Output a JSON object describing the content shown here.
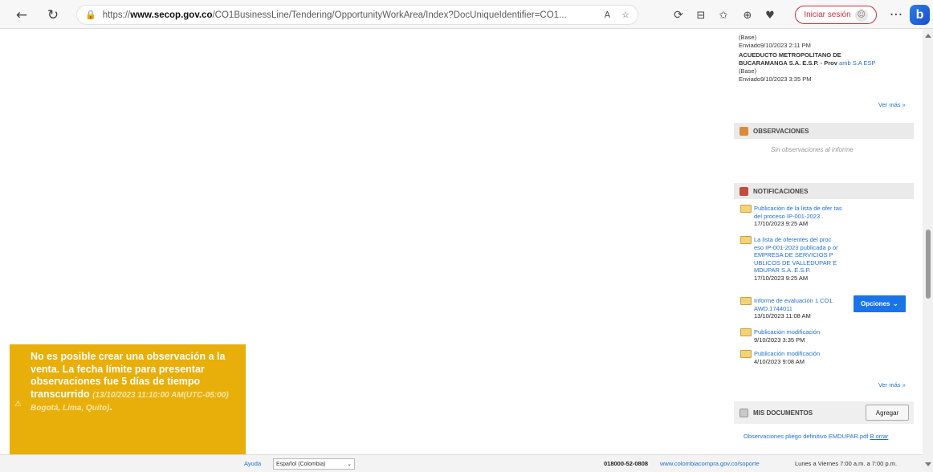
{
  "browser": {
    "url_prefix": "https://",
    "url_host": "www.secop.gov.co",
    "url_path": "/CO1BusinessLine/Tendering/OpportunityWorkArea/Index?DocUniqueIdentifier=CO1...",
    "signin_label": "Iniciar sesión",
    "more_label": "···"
  },
  "offers": {
    "lines": [
      {
        "text": "(Base)"
      },
      {
        "text": "Enviado9/10/2023 2:11 PM"
      },
      {
        "text": "ACUEDUCTO METROPOLITANO DE"
      },
      {
        "text": "BUCARAMANGA S.A. E.S.P. - Prov"
      },
      {
        "text": "(Base)"
      },
      {
        "text": "Enviado9/10/2023 3:35 PM"
      }
    ],
    "proveedor_link": "amb S.A ESP",
    "ver_mas": "Ver más »"
  },
  "observaciones": {
    "title": "OBSERVACIONES",
    "empty_text": "Sin observaciones al informe"
  },
  "notificaciones": {
    "title": "NOTIFICACIONES",
    "items": [
      {
        "title": "Publicación de la lista de ofer tas del proceso IP-001-2023 .",
        "date": "17/10/2023 9:25 AM"
      },
      {
        "title": "La lista de oferentes del proc eso IP-001-2023 publicada p or EMPRESA DE SERVICIOS P UBLICOS DE VALLEDUPAR E MDUPAR S.A. E.S.P.",
        "date": "17/10/2023 9:25 AM"
      },
      {
        "title": "Informe de evaluación 1 CO1. AWD.1744011",
        "date": "13/10/2023 11:08 AM"
      },
      {
        "title": "Publicación modificación",
        "date": "9/10/2023 3:35 PM"
      },
      {
        "title": "Publicación modificación",
        "date": "4/10/2023 9:08 AM"
      }
    ],
    "opciones_label": "Opciones",
    "ver_mas": "Ver más »"
  },
  "mis_documentos": {
    "title": "MIS DOCUMENTOS",
    "agregar_label": "Agregar",
    "doc_name": "Observaciones pliego definitivo EMDUPAR.pdf",
    "doc_action": "B orrar"
  },
  "warning": {
    "message": "No es posible crear una observación a la venta. La fecha límite para presentar observaciones fue 5 días de tiempo transcurrido",
    "deadline": "(13/10/2023 11:10:00 AM(UTC-05:00) Bogotá, Lima, Quito)",
    "end": "."
  },
  "footer": {
    "ayuda": "Ayuda",
    "language": "Español (Colombia)",
    "phone": "018000-52-0808",
    "support_url": "www.colombiacompra.gov.co/soporte",
    "hours": "Lunes a Viernes 7:00 a.m. a 7:00 p.m."
  }
}
